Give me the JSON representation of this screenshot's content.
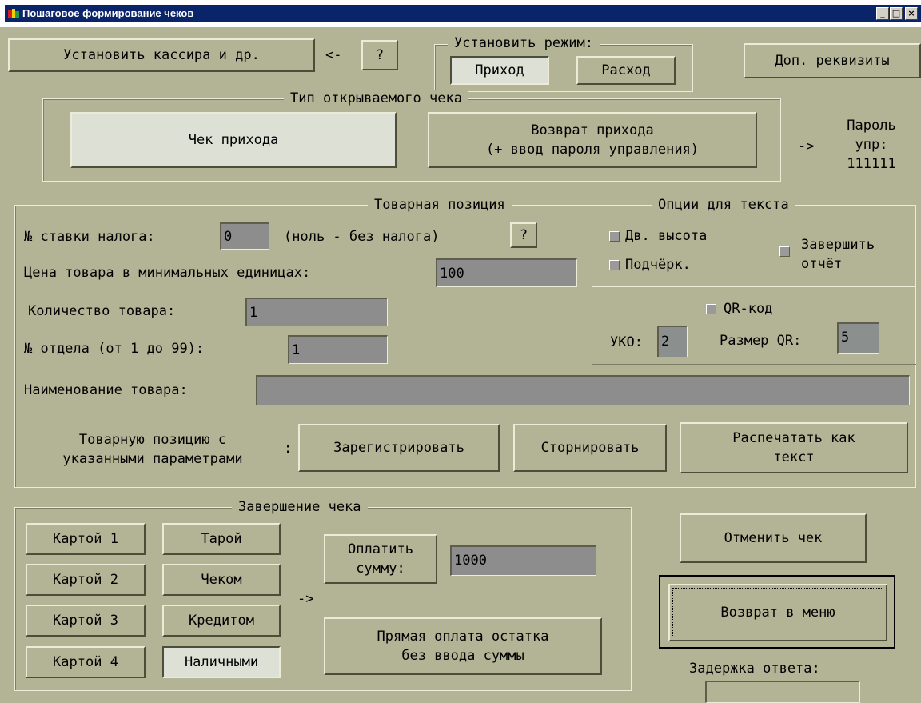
{
  "window": {
    "title": "Пошаговое формирование чеков",
    "minimize": "_",
    "maximize": "□",
    "close": "×"
  },
  "top": {
    "set_cashier": "Установить кассира и др.",
    "arrow_left": "<-",
    "help": "?",
    "mode_group": "Установить режим:",
    "mode_income": "Приход",
    "mode_expense": "Расход",
    "extra_props": "Доп. реквизиты"
  },
  "receipt_type": {
    "group": "Тип открываемого чека",
    "income_receipt": "Чек прихода",
    "income_return": "Возврат прихода\n(+ ввод пароля управления)",
    "arrow": "->",
    "password_label": "Пароль\nупр:\n111111"
  },
  "item": {
    "group": "Товарная позиция",
    "tax_label": "№ ставки налога:",
    "tax_value": "0",
    "tax_hint": "(ноль - без налога)",
    "tax_help": "?",
    "price_label": "Цена товара в минимальных единицах:",
    "price_value": "100",
    "qty_label": "Количество товара:",
    "qty_value": "1",
    "dept_label": "№ отдела (от 1 до 99):",
    "dept_value": "1",
    "name_label": "Наименование товара:",
    "name_value": "",
    "action_label": "Товарную позицию с\nуказанными параметрами",
    "colon": ":",
    "register": "Зарегистрировать",
    "storno": "Сторнировать"
  },
  "text_options": {
    "group": "Опции для текста",
    "double_height": "Дв. высота",
    "underline": "Подчёрк.",
    "finish_report": "Завершить\nотчёт",
    "qr_code": "QR-код",
    "uko_label": "УКО:",
    "uko_value": "2",
    "qr_size_label": "Размер QR:",
    "qr_size_value": "5",
    "print_as_text": "Распечатать как\nтекст"
  },
  "finish": {
    "group": "Завершение чека",
    "card1": "Картой 1",
    "card2": "Картой 2",
    "card3": "Картой 3",
    "card4": "Картой 4",
    "tare": "Тарой",
    "check": "Чеком",
    "credit": "Кредитом",
    "cash": "Наличными",
    "arrow": "->",
    "pay_sum": "Оплатить\nсумму:",
    "pay_value": "1000",
    "direct_pay": "Прямая оплата остатка\nбез ввода суммы"
  },
  "right": {
    "cancel": "Отменить чек",
    "back_menu": "Возврат в меню",
    "delay_label": "Задержка ответа:",
    "delay_value": ""
  }
}
